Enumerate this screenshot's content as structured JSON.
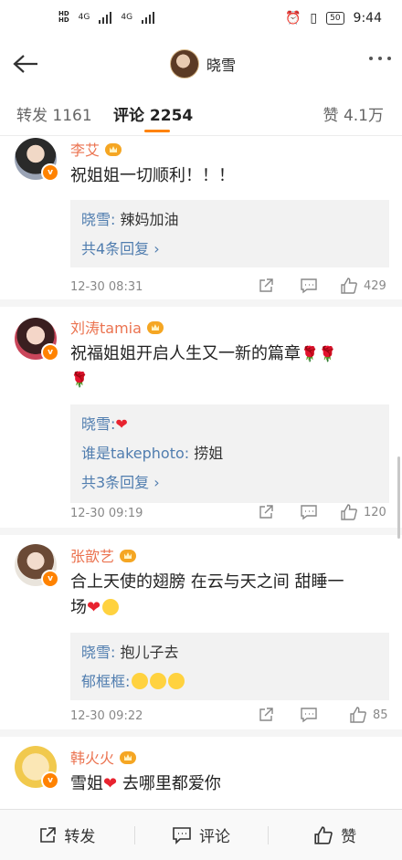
{
  "status_bar": {
    "hd_top": "HD",
    "hd_bottom": "HD",
    "net1": "4G",
    "net2": "4G",
    "battery": "50",
    "time": "9:44"
  },
  "nav": {
    "title": "晓雪",
    "back_icon": "arrow-left-icon",
    "more_icon": "more-dots-icon"
  },
  "tabs": {
    "repost": "转发 1161",
    "comment": "评论 2254",
    "like": "赞 4.1万",
    "accent": "#ff8200"
  },
  "comments": [
    {
      "name": "李艾",
      "text": "祝姐姐一切顺利！！！",
      "replies": [
        {
          "name": "晓雪:",
          "text": " 辣妈加油"
        }
      ],
      "more": "共4条回复 ›",
      "time": "12-30 08:31",
      "likes": "429"
    },
    {
      "name": "刘涛tamia",
      "text_line1": "祝福姐姐开启人生又一新的篇章",
      "replies": [
        {
          "name": "晓雪:",
          "text": ""
        },
        {
          "name": "谁是takephoto:",
          "text": " 捞姐"
        }
      ],
      "more": "共3条回复 ›",
      "time": "12-30 09:19",
      "likes": "120"
    },
    {
      "name": "张歆艺",
      "text_line1": "合上天使的翅膀 在云与天之间 甜睡一",
      "text_line2": "场",
      "replies": [
        {
          "name": "晓雪:",
          "text": " 抱儿子去"
        },
        {
          "name": "郁框框:",
          "text": ""
        }
      ],
      "time": "12-30 09:22",
      "likes": "85"
    },
    {
      "name": "韩火火",
      "text_a": "雪姐",
      "text_b": " 去哪里都爱你"
    }
  ],
  "bottom_bar": {
    "repost": "转发",
    "comment": "评论",
    "like": "赞"
  }
}
